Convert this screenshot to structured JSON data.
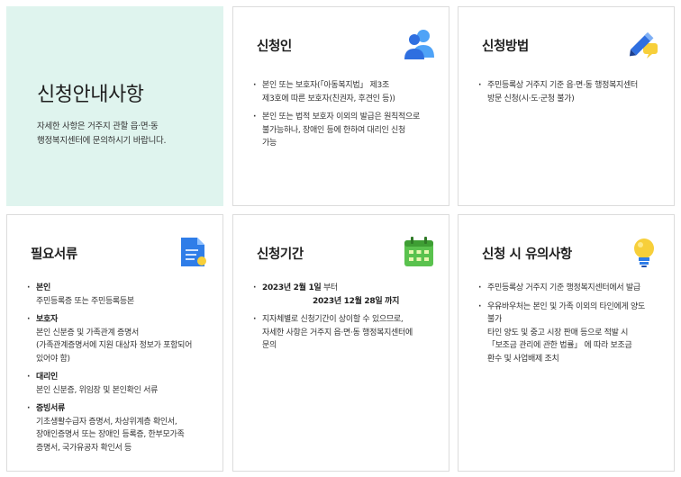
{
  "intro": {
    "title": "신청안내사항",
    "desc_line1": "자세한 사항은 거주지 관할 읍·면·동",
    "desc_line2": "행정복지센터에 문의하시기 바랍니다."
  },
  "applicant": {
    "title": "신청인",
    "icon": "people-icon",
    "b1_l1": "본인 또는 보호자(「아동복지법」 제3조",
    "b1_l2": "제3호에 따른 보호자(친권자, 후견인 등))",
    "b2_l1": "본인 또는 법적 보호자 이외의 발급은 원칙적으로",
    "b2_l2": "불가능하나, 장애인 등에 한하여 대리인 신청",
    "b2_l3": "가능"
  },
  "method": {
    "title": "신청방법",
    "icon": "pencil-icon",
    "b1_l1": "주민등록상 거주지 기준 읍·면·동 행정복지센터",
    "b1_l2": "방문 신청(시·도·군청 불가)"
  },
  "documents": {
    "title": "필요서류",
    "icon": "document-icon",
    "s1_head": "본인",
    "s1_l1": "주민등록증 또는 주민등록등본",
    "s2_head": "보호자",
    "s2_l1": "본인 신분증 및 가족관계 증명서",
    "s2_l2": "(가족관계증명서에 지원 대상자 정보가 포함되어",
    "s2_l3": "있어야 함)",
    "s3_head": "대리인",
    "s3_l1": "본인 신분증, 위임장 및 본인확인 서류",
    "s4_head": "증빙서류",
    "s4_l1": "기초생활수급자 증명서, 차상위계층 확인서,",
    "s4_l2": "장애인증명서 또는 장애인 등록증, 한부모가족",
    "s4_l3": "증명서, 국가유공자 확인서 등"
  },
  "period": {
    "title": "신청기간",
    "icon": "calendar-icon",
    "b1_l1_bold": "2023년 2월 1일",
    "b1_l1_rest": " 부터",
    "b1_l2": "2023년 12월 28일 까지",
    "b2_l1": "지자체별로 신청기간이 상이할 수 있으므로,",
    "b2_l2": "자세한 사항은 거주지 읍·면·동 행정복지센터에",
    "b2_l3": "문의"
  },
  "caution": {
    "title": "신청 시 유의사항",
    "icon": "lightbulb-icon",
    "b1_l1": "주민등록상 거주지 기준 행정복지센터에서 발급",
    "b2_l1": "우유바우처는 본인 및 가족 이외의 타인에게 양도",
    "b2_l2": "불가",
    "b2_l3": "타인 양도 및 중고 시장 판매 등으로 적발 시",
    "b2_l4": "「보조금 관리에 관한 법률」 에 따라 보조금",
    "b2_l5": "환수 및 사업배제 조치"
  },
  "colors": {
    "intro_bg": "#dff4ee",
    "border": "#dcdcdc"
  }
}
